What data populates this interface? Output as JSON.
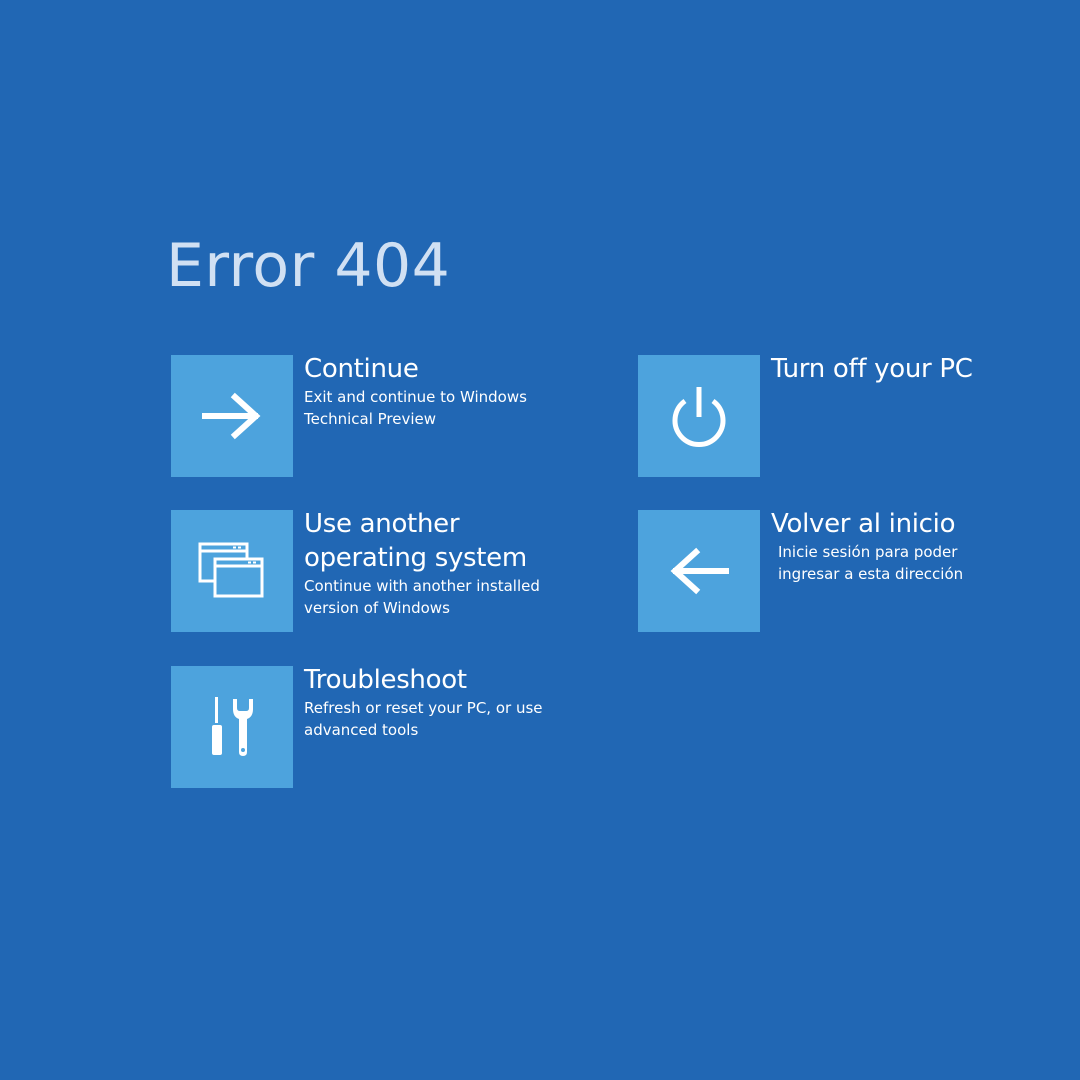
{
  "page": {
    "title": "Error 404",
    "background_color": "#2167b4",
    "tile_color": "#4da3dd"
  },
  "options": {
    "continue": {
      "icon": "arrow-right-icon",
      "title": "Continue",
      "description": "Exit and continue to Windows Technical Preview"
    },
    "turn_off": {
      "icon": "power-icon",
      "title": "Turn off your PC",
      "description": ""
    },
    "another_os": {
      "icon": "windows-stack-icon",
      "title": "Use another operating system",
      "description": "Continue with another installed version of Windows"
    },
    "volver": {
      "icon": "arrow-left-icon",
      "title": "Volver al inicio",
      "description": "Inicie sesión para poder ingresar a esta dirección"
    },
    "troubleshoot": {
      "icon": "tools-icon",
      "title": "Troubleshoot",
      "description": "Refresh or reset your PC, or use advanced tools"
    }
  }
}
